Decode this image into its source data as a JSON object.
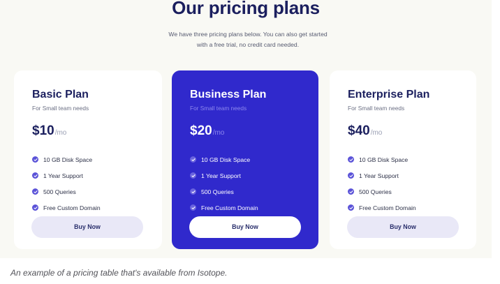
{
  "header": {
    "title": "Our pricing plans",
    "subtitle_line1": "We have three pricing plans below. You can also get started",
    "subtitle_line2": "with a free trial, no credit card needed."
  },
  "plans": [
    {
      "name": "Basic Plan",
      "tagline": "For Small team needs",
      "price": "$10",
      "period": "/mo",
      "features": [
        "10 GB Disk Space",
        "1 Year Support",
        "500 Queries",
        "Free Custom Domain"
      ],
      "button": "Buy Now"
    },
    {
      "name": "Business Plan",
      "tagline": "For Small team needs",
      "price": "$20",
      "period": "/mo",
      "features": [
        "10 GB Disk Space",
        "1 Year Support",
        "500 Queries",
        "Free Custom Domain"
      ],
      "button": "Buy Now"
    },
    {
      "name": "Enterprise Plan",
      "tagline": "For Small team needs",
      "price": "$40",
      "period": "/mo",
      "features": [
        "10 GB Disk Space",
        "1 Year Support",
        "500 Queries",
        "Free Custom Domain"
      ],
      "button": "Buy Now"
    }
  ],
  "caption": "An example of a pricing table that's available from Isotope.",
  "colors": {
    "page_background": "#f9f9f4",
    "card": "#ffffff",
    "featured_card": "#3029cc",
    "heading": "#1b1f5e",
    "check": "#5b53d8",
    "button_light": "#e9e8f7"
  },
  "icons": {
    "feature_bullet": "check-circle-icon"
  }
}
